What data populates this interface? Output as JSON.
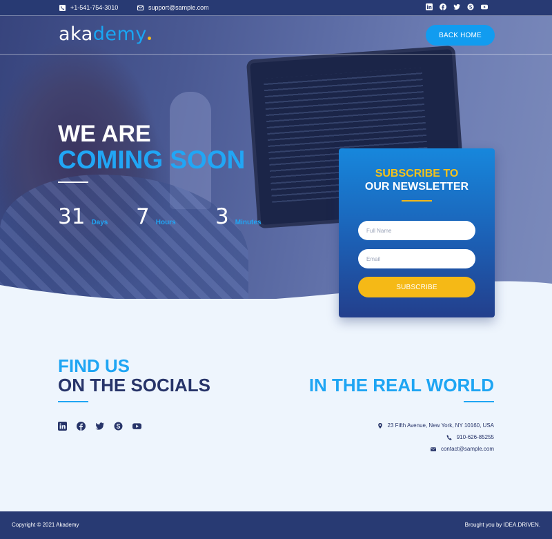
{
  "topbar": {
    "phone": "+1-541-754-3010",
    "email": "support@sample.com",
    "socials": [
      "linkedin-icon",
      "facebook-icon",
      "twitter-icon",
      "skype-icon",
      "youtube-icon"
    ]
  },
  "header": {
    "logo_part1": "aka",
    "logo_part2": "demy",
    "back_home": "BACK HOME"
  },
  "hero": {
    "line1": "WE ARE",
    "line2": "COMING SOON",
    "countdown": [
      {
        "value": "31",
        "unit": "Days"
      },
      {
        "value": "7",
        "unit": "Hours"
      },
      {
        "value": "3",
        "unit": "Minutes"
      }
    ]
  },
  "newsletter": {
    "title1": "SUBSCRIBE TO",
    "title2": "OUR NEWSLETTER",
    "name_placeholder": "Full Name",
    "email_placeholder": "Email",
    "button": "SUBSCRIBE"
  },
  "socials_section": {
    "line1": "FIND US",
    "line2": "ON THE SOCIALS"
  },
  "real_world": {
    "title": "IN THE REAL WORLD",
    "address": "23 Fifth Avenue, New York, NY 10160, USA",
    "phone": "910-626-85255",
    "email": "contact@sample.com"
  },
  "footer": {
    "copyright": "Copyright © 2021 Akademy",
    "brought": "Brought you by IDEA.DRIVEN."
  },
  "colors": {
    "navy": "#283a73",
    "accent_blue": "#1ea5f3",
    "yellow": "#f5b916",
    "background": "#eef5fd"
  }
}
